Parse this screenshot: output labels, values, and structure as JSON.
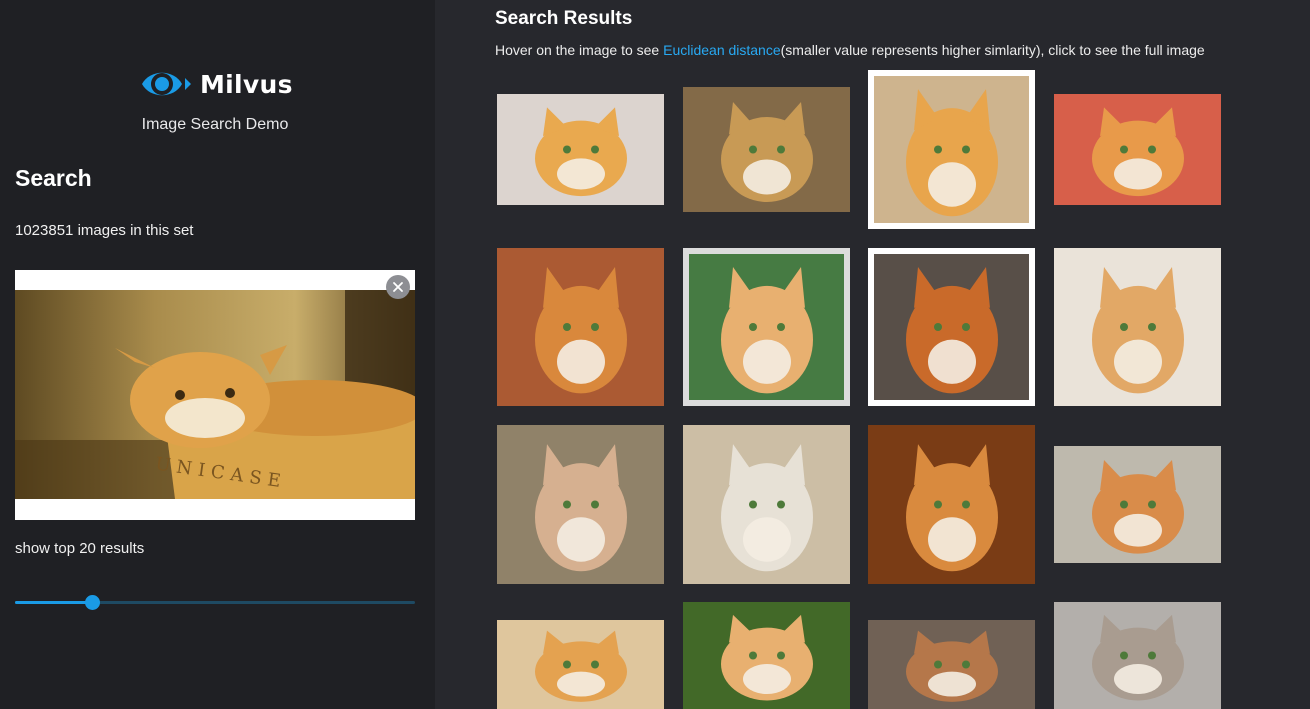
{
  "sidebar": {
    "logo_text": "Milvus",
    "subtitle": "Image Search Demo",
    "search_heading": "Search",
    "image_count_text": "1023851 images in this set",
    "results_label": "show top 20 results",
    "slider": {
      "value": 20,
      "min": 1,
      "max": 100
    }
  },
  "results": {
    "title": "Search Results",
    "instruction_prefix": "Hover on the image to see ",
    "instruction_link": "Euclidean distance",
    "instruction_suffix": "(smaller value represents higher simlarity), click to see the full image"
  },
  "colors": {
    "accent": "#1a9be6",
    "sidebar_bg": "#1f2024",
    "main_bg": "#27282d"
  }
}
